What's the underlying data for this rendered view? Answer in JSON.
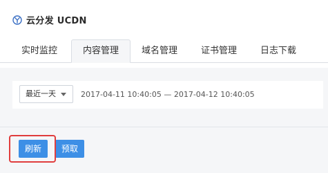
{
  "app": {
    "title": "云分发 UCDN",
    "icon": "ucloud-y-logo-icon"
  },
  "tabs": [
    {
      "label": "实时监控",
      "active": false
    },
    {
      "label": "内容管理",
      "active": true
    },
    {
      "label": "域名管理",
      "active": false
    },
    {
      "label": "证书管理",
      "active": false
    },
    {
      "label": "日志下载",
      "active": false
    }
  ],
  "filter": {
    "time_select": "最近一天",
    "range_text": "2017-04-11 10:40:05 — 2017-04-12 10:40:05"
  },
  "actions": {
    "refresh_label": "刷新",
    "prefetch_label": "预取"
  },
  "colors": {
    "accent": "#3d8fe6",
    "highlight": "#e03d3d",
    "brand_icon": "#3a6fc4"
  }
}
